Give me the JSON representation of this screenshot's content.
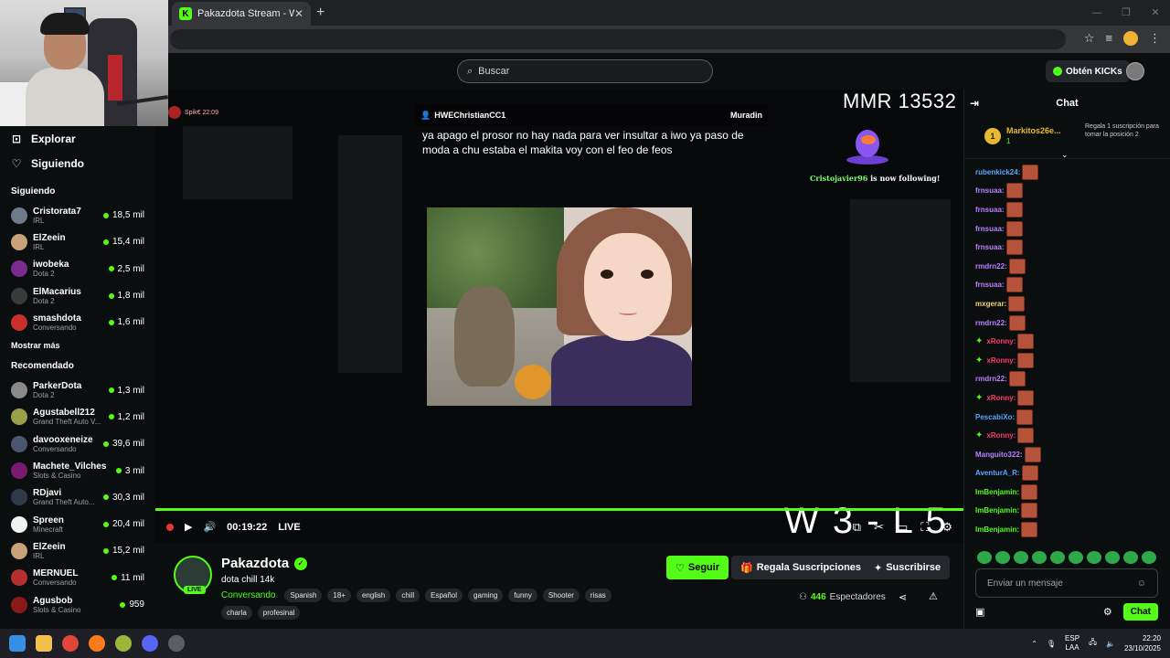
{
  "browser": {
    "tab_title": "Pakazdota Stream - Watch Live",
    "tab_favicon": "K",
    "tab_close": "✕",
    "new_tab": "+"
  },
  "header": {
    "search_placeholder": "Buscar",
    "kicks_label": "Obtén KICKs"
  },
  "sidebar": {
    "nav": [
      {
        "label": "Explorar",
        "icon": "compass-icon"
      },
      {
        "label": "Siguiendo",
        "icon": "heart-icon"
      }
    ],
    "following_title": "Siguiendo",
    "following": [
      {
        "name": "Cristorata7",
        "category": "IRL",
        "viewers": "18,5 mil",
        "color": "#6d7a8a"
      },
      {
        "name": "ElZeein",
        "category": "IRL",
        "viewers": "15,4 mil",
        "color": "#c9a27a"
      },
      {
        "name": "iwobeka",
        "category": "Dota 2",
        "viewers": "2,5 mil",
        "color": "#7b2a8f"
      },
      {
        "name": "ElMacarius",
        "category": "Dota 2",
        "viewers": "1,8 mil",
        "color": "#3a3a3a"
      },
      {
        "name": "smashdota",
        "category": "Conversando",
        "viewers": "1,6 mil",
        "color": "#c9302c"
      }
    ],
    "show_more": "Mostrar más",
    "recommended_title": "Recomendado",
    "recommended": [
      {
        "name": "ParkerDota",
        "category": "Dota 2",
        "viewers": "1,3 mil",
        "color": "#8a8a8a"
      },
      {
        "name": "Agustabell212",
        "category": "Grand Theft Auto V...",
        "viewers": "1,2 mil",
        "color": "#9aa04a"
      },
      {
        "name": "davooxeneize",
        "category": "Conversando",
        "viewers": "39,6 mil",
        "color": "#4a5570"
      },
      {
        "name": "Machete_Vilches",
        "category": "Slots & Casino",
        "viewers": "3 mil",
        "color": "#7a1a6e"
      },
      {
        "name": "RDjavi",
        "category": "Grand Theft Auto...",
        "viewers": "30,3 mil",
        "color": "#2d3a4a"
      },
      {
        "name": "Spreen",
        "category": "Minecraft",
        "viewers": "20,4 mil",
        "color": "#f2f2f2"
      },
      {
        "name": "ElZeein",
        "category": "IRL",
        "viewers": "15,2 mil",
        "color": "#c9a27a"
      },
      {
        "name": "MERNUEL",
        "category": "Conversando",
        "viewers": "11 mil",
        "color": "#b5302c"
      },
      {
        "name": "Agusbob",
        "category": "Slots & Casino",
        "viewers": "959",
        "color": "#8a1a1a"
      }
    ]
  },
  "video": {
    "streamer_tag": "Spik€ 22:09",
    "msg_user": "HWEChristianCC1",
    "msg_target": "Muradin",
    "msg_text": "ya apago el prosor no hay nada para ver insultar a iwo ya paso de moda a chu estaba el makita voy con el feo de feos",
    "mmr": "MMR 13532",
    "follow_name": "Cristojavier96",
    "follow_text": " is now following!",
    "wl": "W 3 - L 5",
    "time": "00:19:22",
    "live": "LIVE"
  },
  "channel": {
    "name": "Pakazdota",
    "live_badge": "LIVE",
    "title": "dota chill 14k",
    "category": "Conversando",
    "tags": [
      "Spanish",
      "18+",
      "english",
      "chill",
      "Español",
      "gaming",
      "funny",
      "Shooter",
      "risas",
      "charla",
      "profesinal"
    ],
    "follow_label": "Seguir",
    "gift_label": "Regala Suscripciones",
    "subscribe_label": "Suscribirse",
    "viewers_count": "446",
    "viewers_label": "Espectadores"
  },
  "chat": {
    "title": "Chat",
    "pinned_rank": "1",
    "pinned_user": "Markitos26e...",
    "pinned_count": "1",
    "pinned_gift": "Regala 1 suscripción para tomar la posición 2",
    "messages": [
      {
        "user": "rubenkick24:",
        "color": "#5aa6ff",
        "badge": ""
      },
      {
        "user": "frnsuaa:",
        "color": "#b980ff",
        "badge": ""
      },
      {
        "user": "frnsuaa:",
        "color": "#b980ff",
        "badge": ""
      },
      {
        "user": "frnsuaa:",
        "color": "#b980ff",
        "badge": ""
      },
      {
        "user": "frnsuaa:",
        "color": "#b980ff",
        "badge": ""
      },
      {
        "user": "rmdrn22:",
        "color": "#b980ff",
        "badge": ""
      },
      {
        "user": "frnsuaa:",
        "color": "#b980ff",
        "badge": ""
      },
      {
        "user": "mxgerar:",
        "color": "#f2d46b",
        "badge": ""
      },
      {
        "user": "rmdrn22:",
        "color": "#b980ff",
        "badge": ""
      },
      {
        "user": "xRonny:",
        "color": "#ff3b6b",
        "badge": "✦"
      },
      {
        "user": "xRonny:",
        "color": "#ff3b6b",
        "badge": "✦"
      },
      {
        "user": "rmdrn22:",
        "color": "#b980ff",
        "badge": ""
      },
      {
        "user": "xRonny:",
        "color": "#ff3b6b",
        "badge": "✦"
      },
      {
        "user": "PescabiXo:",
        "color": "#5aa6ff",
        "badge": ""
      },
      {
        "user": "xRonny:",
        "color": "#ff3b6b",
        "badge": "✦"
      },
      {
        "user": "Manguito322:",
        "color": "#b980ff",
        "badge": ""
      },
      {
        "user": "AventurA_R:",
        "color": "#5aa6ff",
        "badge": ""
      },
      {
        "user": "ImBenjamin:",
        "color": "#53fc18",
        "badge": ""
      },
      {
        "user": "ImBenjamin:",
        "color": "#53fc18",
        "badge": ""
      },
      {
        "user": "ImBenjamin:",
        "color": "#53fc18",
        "badge": ""
      }
    ],
    "input_placeholder": "Enviar un mensaje",
    "send_label": "Chat"
  },
  "taskbar": {
    "lang_top": "ESP",
    "lang_bottom": "LAA",
    "time": "22:20",
    "date": "23/10/2025"
  },
  "colors": {
    "accent": "#53fc18",
    "background": "#0b0e0f"
  }
}
